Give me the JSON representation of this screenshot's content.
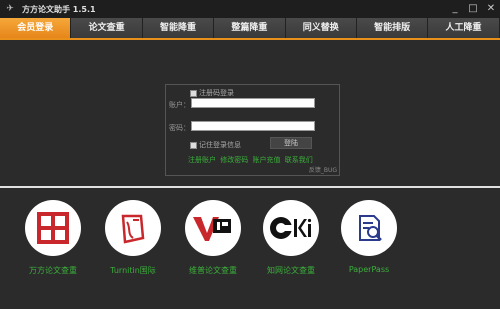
{
  "window": {
    "title": "方方论文助手 1.5.1",
    "controls": [
      "_",
      "□",
      "✕"
    ]
  },
  "tabs": [
    {
      "label": "会员登录",
      "active": true
    },
    {
      "label": "论文查重",
      "active": false
    },
    {
      "label": "智能降重",
      "active": false
    },
    {
      "label": "整篇降重",
      "active": false
    },
    {
      "label": "同义替换",
      "active": false
    },
    {
      "label": "智能排版",
      "active": false
    },
    {
      "label": "人工降重",
      "active": false
    }
  ],
  "login": {
    "register_code_login": "注册码登录",
    "account_label": "账户：",
    "account_value": "",
    "password_label": "密码：",
    "password_value": "",
    "remember_label": "记住登录信息",
    "login_button": "登陆",
    "links": [
      "注册账户",
      "修改密码",
      "账户充值",
      "联系我们"
    ],
    "feedback": "反馈_BUG"
  },
  "services": [
    {
      "label": "万方论文查重",
      "icon": "wanfang-logo-icon"
    },
    {
      "label": "Turnitin国际",
      "icon": "turnitin-logo-icon"
    },
    {
      "label": "维普论文查重",
      "icon": "vip-logo-icon"
    },
    {
      "label": "知网论文查重",
      "icon": "cnki-logo-icon"
    },
    {
      "label": "PaperPass",
      "icon": "paperpass-logo-icon"
    }
  ],
  "colors": {
    "accent": "#e8901a",
    "link_green": "#3bb03b",
    "background": "#2b2b2b"
  }
}
